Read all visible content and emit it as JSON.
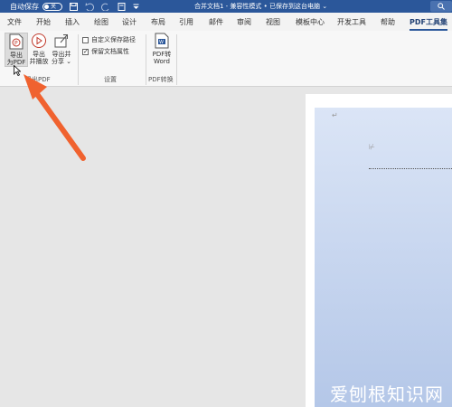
{
  "titlebar": {
    "autosave_label": "自动保存",
    "autosave_state": "关",
    "document_title": "合并文档1 - 兼容性模式 • 已保存到这台电脑 ⌄"
  },
  "tabs": [
    {
      "label": "文件"
    },
    {
      "label": "开始"
    },
    {
      "label": "插入"
    },
    {
      "label": "绘图"
    },
    {
      "label": "设计"
    },
    {
      "label": "布局"
    },
    {
      "label": "引用"
    },
    {
      "label": "邮件"
    },
    {
      "label": "审阅"
    },
    {
      "label": "视图"
    },
    {
      "label": "模板中心"
    },
    {
      "label": "开发工具"
    },
    {
      "label": "帮助"
    },
    {
      "label": "PDF工具集",
      "active": true
    }
  ],
  "ribbon": {
    "export_pdf": {
      "line1": "导出",
      "line2": "为PDF"
    },
    "export_play": {
      "line1": "导出",
      "line2": "并播放"
    },
    "export_share": {
      "line1": "导出并",
      "line2": "分享 ⌄"
    },
    "group1_label": "导出PDF",
    "custom_save_path": {
      "label": "自定义保存路径",
      "checked": false
    },
    "keep_doc_props": {
      "label": "保留文档属性",
      "checked": true
    },
    "group2_label": "设置",
    "pdf_to_word": {
      "line1": "PDF转",
      "line2": "Word"
    },
    "group3_label": "PDF转换"
  },
  "colors": {
    "titlebar": "#2b579a",
    "arrow": "#f0622f",
    "watermark": "#ffffff"
  },
  "watermark": "爱刨根知识网"
}
